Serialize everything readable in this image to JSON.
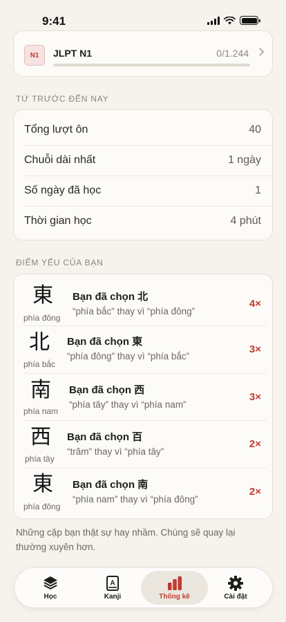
{
  "status_bar": {
    "time": "9:41"
  },
  "jlpt": {
    "badge": "N1",
    "title": "JLPT N1",
    "progress_text": "0/1.244",
    "progress": 0
  },
  "lifetime": {
    "section_title": "TỪ TRƯỚC ĐẾN NAY",
    "rows": [
      {
        "label": "Tổng lượt ôn",
        "value": "40"
      },
      {
        "label": "Chuỗi dài nhất",
        "value": "1 ngày"
      },
      {
        "label": "Số ngày đã học",
        "value": "1"
      },
      {
        "label": "Thời gian học",
        "value": "4 phút"
      }
    ]
  },
  "weak_spots": {
    "section_title": "ĐIỂM YẾU CỦA BẠN",
    "items": [
      {
        "kanji": "東",
        "meaning": "phía đông",
        "chose": "Bạn đã chọn 北",
        "detail": "“phía bắc” thay vì “phía đông”",
        "count": "4×"
      },
      {
        "kanji": "北",
        "meaning": "phía bắc",
        "chose": "Bạn đã chọn 東",
        "detail": "“phía đông” thay vì “phía bắc”",
        "count": "3×"
      },
      {
        "kanji": "南",
        "meaning": "phía nam",
        "chose": "Bạn đã chọn 西",
        "detail": "“phía tây” thay vì “phía nam”",
        "count": "3×"
      },
      {
        "kanji": "西",
        "meaning": "phía tây",
        "chose": "Bạn đã chọn 百",
        "detail": "“trăm” thay vì “phía tây”",
        "count": "2×"
      },
      {
        "kanji": "東",
        "meaning": "phía đông",
        "chose": "Bạn đã chọn 南",
        "detail": "“phía nam” thay vì “phía đông”",
        "count": "2×"
      }
    ],
    "footnote": "Những cặp bạn thật sự hay nhầm. Chúng sẽ quay lại thường xuyên hơn."
  },
  "tabbar": {
    "tabs": [
      {
        "label": "Học",
        "icon": "layers-icon"
      },
      {
        "label": "Kanji",
        "icon": "kanji-book-icon"
      },
      {
        "label": "Thống kê",
        "icon": "bar-chart-icon",
        "active": true
      },
      {
        "label": "Cài đặt",
        "icon": "gear-icon"
      }
    ]
  },
  "colors": {
    "accent": "#c13a32",
    "background": "#f6f3ed",
    "card": "#fcfbf8"
  }
}
